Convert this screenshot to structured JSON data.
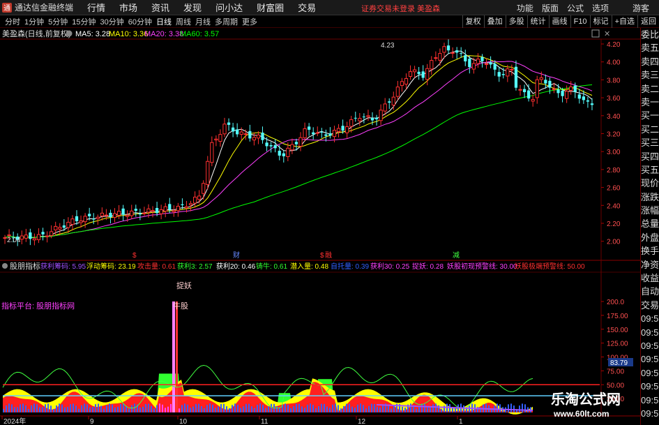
{
  "window": {
    "app_title": "通达信金融终端",
    "menu": [
      "行情",
      "市场",
      "资讯",
      "发现",
      "问小达",
      "财富圈",
      "交易"
    ],
    "notice": "证券交易未登录  美盈森",
    "right_menu": [
      "功能",
      "版面",
      "公式",
      "选项"
    ],
    "guest_label": "游客"
  },
  "period_bar": {
    "periods": [
      "分时",
      "1分钟",
      "5分钟",
      "15分钟",
      "30分钟",
      "60分钟",
      "日线",
      "周线",
      "月线",
      "多周期",
      "更多"
    ],
    "active_period": "日线",
    "tools": [
      "复权",
      "叠加",
      "多股",
      "统计",
      "画线",
      "F10",
      "标记",
      "+自选",
      "返回"
    ]
  },
  "main_chart": {
    "stock_title": "美盈森(日线,前复权)",
    "ma_legend": [
      {
        "label": "MA5: 3.28",
        "color": "#ffffff"
      },
      {
        "label": "MA10: 3.36",
        "color": "#ffff00"
      },
      {
        "label": "MA20: 3.38",
        "color": "#ff40ff"
      },
      {
        "label": "MA60: 3.57",
        "color": "#00ff00"
      }
    ],
    "y_ticks": [
      "4.20",
      "4.00",
      "3.80",
      "3.60",
      "3.40",
      "3.20",
      "3.00",
      "2.80",
      "2.60",
      "2.40",
      "2.20",
      "2.00"
    ],
    "high_label": "4.23",
    "low_label": "2.04",
    "event_markers": [
      {
        "text": "$",
        "color": "#ff3030"
      },
      {
        "text": "财",
        "color": "#6688ff"
      },
      {
        "text": "$",
        "color": "#ff3030"
      },
      {
        "text": "融",
        "color": "#ff3030"
      },
      {
        "text": "减",
        "color": "#40ff40"
      }
    ]
  },
  "indicator": {
    "name": "股朋指标",
    "legend": [
      {
        "label": "获利筹码: 5.95",
        "color": "#a050ff"
      },
      {
        "label": "浮动筹码: 23.19",
        "color": "#ffff00"
      },
      {
        "label": "攻击量: 0.61",
        "color": "#ff3030"
      },
      {
        "label": "获利3: 2.57",
        "color": "#30ff30"
      },
      {
        "label": "获利20: 0.46",
        "color": "#ffffff"
      },
      {
        "label": "铸牛: 0.61",
        "color": "#30ff30"
      },
      {
        "label": "潜入量: 0.48",
        "color": "#ffff00"
      },
      {
        "label": "自托量: 0.39",
        "color": "#3060ff"
      },
      {
        "label": "获利30: 0.25",
        "color": "#ff40ff"
      },
      {
        "label": "捉妖: 0.28",
        "color": "#ff40ff"
      },
      {
        "label": "妖股初现预警线: 30.00",
        "color": "#ff40ff"
      },
      {
        "label": "妖股极端预警线: 50.00",
        "color": "#ff3030"
      }
    ],
    "platform_label": "指标平台: 股朋指标网",
    "annotations": [
      "捉妖",
      "牛股"
    ],
    "y_ticks": [
      "200.0",
      "175.00",
      "150.00",
      "125.00",
      "100.00",
      "75.00",
      "50.00",
      "25.00"
    ],
    "current_value": "83.79"
  },
  "time_axis": {
    "labels": [
      "2024年",
      "9",
      "10",
      "11",
      "12",
      "1"
    ]
  },
  "right_panel": {
    "items": [
      {
        "label": "委比",
        "tone": "normal"
      },
      {
        "label": "卖五",
        "tone": "normal"
      },
      {
        "label": "卖四",
        "tone": "normal"
      },
      {
        "label": "卖三",
        "tone": "normal"
      },
      {
        "label": "卖二",
        "tone": "normal"
      },
      {
        "label": "卖一",
        "tone": "normal"
      },
      {
        "label": "买一",
        "tone": "normal"
      },
      {
        "label": "买二",
        "tone": "normal"
      },
      {
        "label": "买三",
        "tone": "normal"
      },
      {
        "label": "买四",
        "tone": "normal"
      },
      {
        "label": "买五",
        "tone": "normal"
      },
      {
        "label": "现价",
        "tone": "normal"
      },
      {
        "label": "涨跌",
        "tone": "normal"
      },
      {
        "label": "涨幅",
        "tone": "normal"
      },
      {
        "label": "总量",
        "tone": "normal"
      },
      {
        "label": "外盘",
        "tone": "normal"
      },
      {
        "label": "换手",
        "tone": "normal"
      },
      {
        "label": "净资",
        "tone": "normal"
      },
      {
        "label": "收益",
        "tone": "normal"
      },
      {
        "label": "自动",
        "tone": "normal"
      },
      {
        "label": "交易",
        "tone": "normal"
      },
      {
        "label": "09:59",
        "tone": "normal"
      },
      {
        "label": "09:59",
        "tone": "normal"
      },
      {
        "label": "09:59",
        "tone": "normal"
      },
      {
        "label": "09:59",
        "tone": "normal"
      },
      {
        "label": "09:59",
        "tone": "normal"
      },
      {
        "label": "09:59",
        "tone": "normal"
      },
      {
        "label": "09:59",
        "tone": "normal"
      },
      {
        "label": "09:59",
        "tone": "normal"
      }
    ]
  },
  "watermark": {
    "cn": "乐淘公式网",
    "url": "www.60lt.com"
  }
}
